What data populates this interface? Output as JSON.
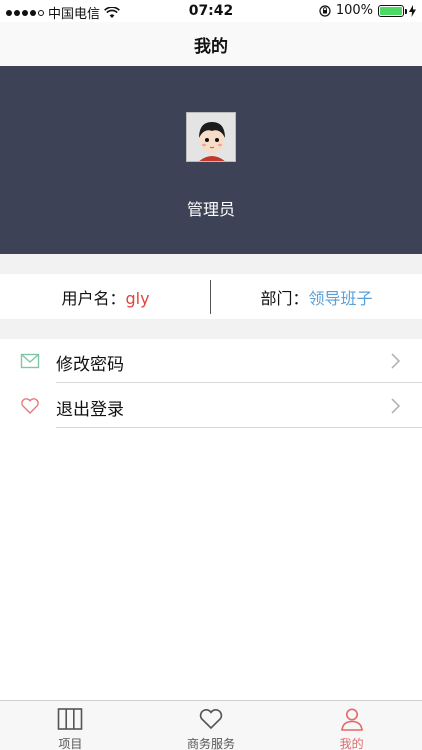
{
  "status_bar": {
    "carrier": "中国电信",
    "time": "07:42",
    "battery_percent": "100%",
    "signal_bars_filled": 4,
    "signal_bars_total": 5
  },
  "nav": {
    "title": "我的"
  },
  "profile": {
    "name": "管理员",
    "background_color": "#3e4256"
  },
  "info": {
    "username_label": "用户名：",
    "username_value": "gly",
    "department_label": "部门：",
    "department_value": "领导班子"
  },
  "menu": {
    "items": [
      {
        "label": "修改密码",
        "icon": "mail-icon"
      },
      {
        "label": "退出登录",
        "icon": "heart-icon"
      }
    ]
  },
  "tabbar": {
    "tabs": [
      {
        "label": "项目",
        "icon": "columns-icon"
      },
      {
        "label": "商务服务",
        "icon": "heart-icon"
      },
      {
        "label": "我的",
        "icon": "person-icon",
        "active": true
      }
    ],
    "active_color": "#e06b6b"
  }
}
